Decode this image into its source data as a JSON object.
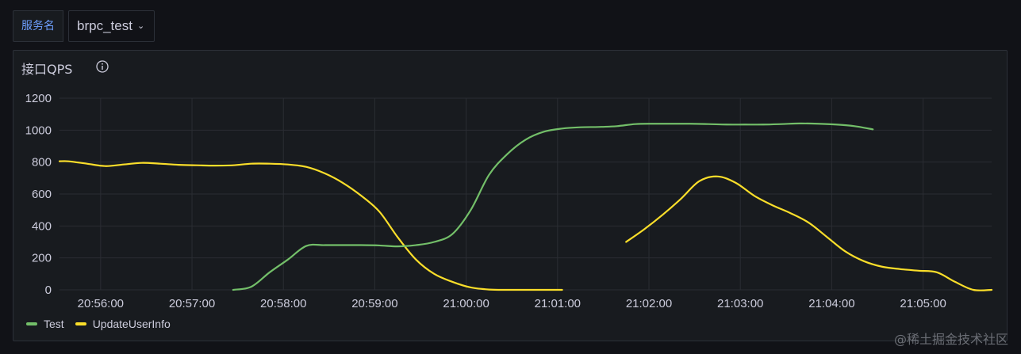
{
  "variables": {
    "label": "服务名",
    "selected": "brpc_test"
  },
  "panel": {
    "title": "接口QPS",
    "info_icon": "info-circle-icon"
  },
  "colors": {
    "Test": "#73bf69",
    "UpdateUserInfo": "#fade2a",
    "grid": "#2a2d33",
    "axis_text": "#ccccdc"
  },
  "watermark": "@稀土掘金技术社区",
  "chart_data": {
    "type": "line",
    "title": "接口QPS",
    "ylim": [
      0,
      1200
    ],
    "yticks": [
      0,
      200,
      400,
      600,
      800,
      1000,
      1200
    ],
    "xticks": [
      "20:56:00",
      "20:57:00",
      "20:58:00",
      "20:59:00",
      "21:00:00",
      "21:01:00",
      "21:02:00",
      "21:03:00",
      "21:04:00",
      "21:05:00"
    ],
    "xrange_minutes": [
      20.55,
      25.65
    ],
    "grid": true,
    "legend_position": "bottom-left",
    "series": [
      {
        "name": "Test",
        "segments": [
          [
            [
              21.5,
              0
            ],
            [
              21.6,
              20
            ],
            [
              21.7,
              110
            ],
            [
              21.8,
              190
            ],
            [
              21.9,
              275
            ],
            [
              22.0,
              280
            ],
            [
              22.1,
              280
            ],
            [
              22.2,
              280
            ],
            [
              22.3,
              278
            ],
            [
              22.4,
              272
            ],
            [
              22.5,
              280
            ],
            [
              22.6,
              300
            ],
            [
              22.7,
              350
            ],
            [
              22.8,
              500
            ],
            [
              22.9,
              720
            ],
            [
              23.0,
              850
            ],
            [
              23.1,
              940
            ],
            [
              23.2,
              990
            ],
            [
              23.3,
              1010
            ],
            [
              23.4,
              1018
            ],
            [
              23.5,
              1020
            ],
            [
              23.6,
              1025
            ],
            [
              23.7,
              1038
            ],
            [
              23.8,
              1040
            ],
            [
              23.9,
              1040
            ],
            [
              24.0,
              1040
            ],
            [
              24.1,
              1038
            ],
            [
              24.2,
              1035
            ],
            [
              24.3,
              1035
            ],
            [
              24.4,
              1035
            ],
            [
              24.5,
              1038
            ],
            [
              24.6,
              1042
            ],
            [
              24.7,
              1040
            ],
            [
              24.8,
              1035
            ],
            [
              24.9,
              1025
            ],
            [
              25.0,
              1005
            ]
          ]
        ]
      },
      {
        "name": "UpdateUserInfo",
        "segments": [
          [
            [
              20.55,
              805
            ],
            [
              20.6,
              805
            ],
            [
              20.7,
              790
            ],
            [
              20.8,
              775
            ],
            [
              20.9,
              785
            ],
            [
              21.0,
              795
            ],
            [
              21.1,
              790
            ],
            [
              21.2,
              783
            ],
            [
              21.3,
              780
            ],
            [
              21.4,
              778
            ],
            [
              21.5,
              780
            ],
            [
              21.6,
              790
            ],
            [
              21.7,
              790
            ],
            [
              21.8,
              785
            ],
            [
              21.9,
              770
            ],
            [
              22.0,
              730
            ],
            [
              22.1,
              670
            ],
            [
              22.2,
              590
            ],
            [
              22.3,
              490
            ],
            [
              22.4,
              330
            ],
            [
              22.5,
              190
            ],
            [
              22.6,
              100
            ],
            [
              22.7,
              50
            ],
            [
              22.8,
              15
            ],
            [
              22.9,
              2
            ],
            [
              23.0,
              0
            ],
            [
              23.1,
              0
            ],
            [
              23.2,
              0
            ],
            [
              23.3,
              0
            ]
          ],
          [
            [
              23.65,
              300
            ],
            [
              23.75,
              380
            ],
            [
              23.85,
              470
            ],
            [
              23.95,
              570
            ],
            [
              24.05,
              680
            ],
            [
              24.15,
              710
            ],
            [
              24.25,
              670
            ],
            [
              24.35,
              590
            ],
            [
              24.45,
              530
            ],
            [
              24.55,
              480
            ],
            [
              24.65,
              420
            ],
            [
              24.75,
              330
            ],
            [
              24.85,
              240
            ],
            [
              24.95,
              180
            ],
            [
              25.05,
              145
            ],
            [
              25.15,
              130
            ],
            [
              25.25,
              120
            ],
            [
              25.35,
              110
            ],
            [
              25.45,
              50
            ],
            [
              25.55,
              0
            ],
            [
              25.65,
              0
            ]
          ]
        ]
      }
    ]
  }
}
